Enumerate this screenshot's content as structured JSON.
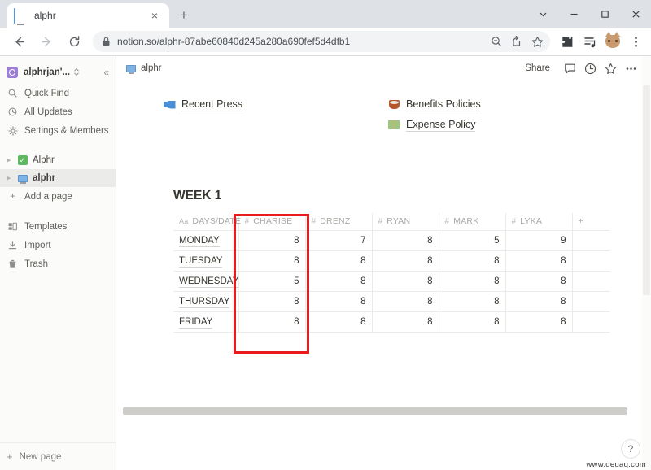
{
  "browser": {
    "tab": {
      "title": "alphr",
      "favicon": "monitor-icon",
      "close": "×"
    },
    "new_tab": "+",
    "window_controls": {
      "minimize": "—",
      "maximize": "□",
      "close": "×",
      "chevron": "⌄"
    },
    "nav": {
      "back": "←",
      "forward": "→",
      "reload": "↻"
    },
    "url": "notion.so/alphr-87abe60840d245a280a690fef5d4dfb1",
    "omnibox_icons": [
      "zoom-out-icon",
      "share-icon",
      "bookmark-star-icon"
    ],
    "toolbar_icons": [
      "extensions-puzzle-icon",
      "reading-list-icon",
      "profile-avatar-cat",
      "chrome-menu-icon"
    ]
  },
  "sidebar": {
    "workspace": {
      "name": "alphrjan'...",
      "chevron": "⌃⌄",
      "collapse": "«"
    },
    "items": [
      {
        "label": "Quick Find",
        "icon": "search-icon"
      },
      {
        "label": "All Updates",
        "icon": "clock-icon"
      },
      {
        "label": "Settings & Members",
        "icon": "gear-icon"
      }
    ],
    "pages": [
      {
        "label": "Alphr",
        "icon": "green-check-icon",
        "active": false
      },
      {
        "label": "alphr",
        "icon": "monitor-icon",
        "active": true
      }
    ],
    "add_page": {
      "label": "Add a page",
      "icon": "plus-icon"
    },
    "tools": [
      {
        "label": "Templates",
        "icon": "templates-icon"
      },
      {
        "label": "Import",
        "icon": "import-icon"
      },
      {
        "label": "Trash",
        "icon": "trash-icon"
      }
    ],
    "new_page": {
      "label": "New page",
      "icon": "plus-icon"
    }
  },
  "topbar": {
    "breadcrumb": "alphr",
    "share_label": "Share",
    "icons": [
      "comment-icon",
      "updates-clock-icon",
      "favorite-star-icon",
      "more-options-icon"
    ]
  },
  "page": {
    "links_left": [
      {
        "label": "Recent Press",
        "emoji": "megaphone-icon"
      }
    ],
    "links_right": [
      {
        "label": "Benefits Policies",
        "emoji": "coffee-icon"
      },
      {
        "label": "Expense Policy",
        "emoji": "money-icon"
      }
    ],
    "week_title": "WEEK 1",
    "table": {
      "columns": [
        {
          "label": "DAYS/DATE",
          "type_icon": "Aa"
        },
        {
          "label": "CHARISE",
          "type_icon": "#"
        },
        {
          "label": "DRENZ",
          "type_icon": "#"
        },
        {
          "label": "RYAN",
          "type_icon": "#"
        },
        {
          "label": "MARK",
          "type_icon": "#"
        },
        {
          "label": "LYKA",
          "type_icon": "#"
        },
        {
          "label": "+",
          "type_icon": ""
        }
      ],
      "rows": [
        {
          "day": "MONDAY",
          "values": [
            "8",
            "7",
            "8",
            "5",
            "9"
          ]
        },
        {
          "day": "TUESDAY",
          "values": [
            "8",
            "8",
            "8",
            "8",
            "8"
          ]
        },
        {
          "day": "WEDNESDAY",
          "values": [
            "5",
            "8",
            "8",
            "8",
            "8"
          ]
        },
        {
          "day": "THURSDAY",
          "values": [
            "8",
            "8",
            "8",
            "8",
            "8"
          ]
        },
        {
          "day": "FRIDAY",
          "values": [
            "8",
            "8",
            "8",
            "8",
            "8"
          ]
        }
      ]
    },
    "annotation": {
      "color": "#e81c1c",
      "target_column": "CHARISE"
    },
    "help_button": "?",
    "watermark": "www.deuaq.com"
  }
}
